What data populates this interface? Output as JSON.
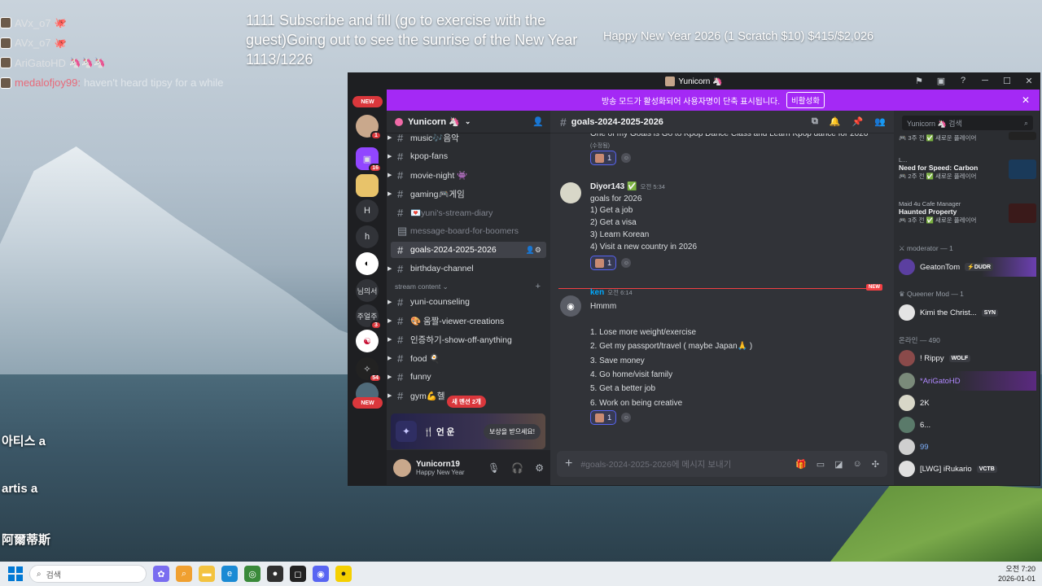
{
  "overlay_chat": [
    {
      "name": "AVx_o7",
      "message": "",
      "emoji": "🐙",
      "highlight": false
    },
    {
      "name": "AVx_o7",
      "message": "",
      "emoji": "🐙",
      "highlight": false
    },
    {
      "name": "AriGatoHD",
      "message": "",
      "emoji": "🦄🦄🦄",
      "highlight": false
    },
    {
      "name": "medalofjoy99:",
      "message": "haven't heard tipsy for a while",
      "emoji": "",
      "highlight": true
    }
  ],
  "stream_goal": "1111 Subscribe and fill (go to exercise with the guest)Going out to see the sunrise of the New Year 1113/1226",
  "new_year_goal": "Happy New Year 2026 (1 Scratch $10) $415/$2,026",
  "side_labels": [
    "아티스 a",
    "artis a",
    "阿爾蒂斯"
  ],
  "window": {
    "title": "Yunicorn 🦄",
    "banner_text": "방송 모드가 활성화되어 사용자명이 단축 표시됩니다.",
    "banner_button": "비활성화",
    "close_x": "✕"
  },
  "servers": {
    "new_pill": "NEW",
    "badges": [
      "1",
      "16",
      "3",
      "54"
    ],
    "letters": [
      "H",
      "h",
      "님의서",
      "주얼주"
    ]
  },
  "guild": {
    "name": "Yunicorn 🦄"
  },
  "channels": [
    {
      "name": "music🎶음악",
      "arrow": true,
      "muted": false
    },
    {
      "name": "kpop-fans",
      "arrow": true,
      "muted": false
    },
    {
      "name": "movie-night 👾",
      "arrow": true,
      "muted": false
    },
    {
      "name": "gaming🎮게임",
      "arrow": true,
      "muted": false
    },
    {
      "name": "💌yuni's-stream-diary",
      "arrow": false,
      "muted": true
    },
    {
      "name": "message-board-for-boomers",
      "arrow": false,
      "muted": true
    },
    {
      "name": "goals-2024-2025-2026",
      "arrow": false,
      "muted": false,
      "selected": true
    },
    {
      "name": "birthday-channel",
      "arrow": true,
      "muted": false
    }
  ],
  "category": "stream content ⌄",
  "channels2": [
    {
      "name": "yuni-counseling",
      "arrow": true
    },
    {
      "name": "🎨 움짤-viewer-creations",
      "arrow": true
    },
    {
      "name": "인증하기-show-off-anything",
      "arrow": true
    },
    {
      "name": "food 🍳",
      "arrow": true
    },
    {
      "name": "funny",
      "arrow": true
    },
    {
      "name": "gym💪헬",
      "arrow": true
    }
  ],
  "new_mentions": "새 멘션 2개",
  "reward": {
    "name": "🍴 언 운",
    "button": "보상을 받으세요!"
  },
  "user": {
    "name": "Yunicorn19",
    "status": "Happy New Year"
  },
  "chat": {
    "channel": "goals-2024-2025-2026",
    "messages": [
      {
        "author": "",
        "time": "",
        "lines": [
          "One of my Goals is Go to Kpop Dance Class and Learn Kpop dance for 2026",
          "(수정됨)"
        ],
        "reaction_count": "1"
      },
      {
        "author": "Diyor143 ✅",
        "time": "오전 5:34",
        "lines": [
          "goals for 2026",
          "1) Get a job",
          "2) Get a visa",
          "3) Learn Korean",
          "4) Visit a new country in 2026"
        ],
        "reaction_count": "1"
      },
      {
        "author": "ken",
        "time": "오전 6:14",
        "lines": [
          "Hmmm",
          "",
          "1. Lose more weight/exercise",
          "2. Get my passport/travel ( maybe Japan🙏 )",
          "3. Save money",
          "4. Go home/visit family",
          "5. Get a better job",
          "6. Work on being creative"
        ],
        "reaction_count": "1"
      }
    ],
    "new_tag": "NEW",
    "placeholder": "#goals-2024-2025-2026에 메시지 보내기"
  },
  "members": {
    "search": "Yunicorn 🦄 검색",
    "cards": [
      {
        "title": "",
        "sub": "🎮 3주 전 ✅ 새로운 플레이어"
      },
      {
        "title": "Need for Speed: Carbon",
        "sub": "🎮 2주 전 ✅ 새로운 플레이어",
        "pre": "L..."
      },
      {
        "title": "Haunted Property",
        "sub": "🎮 3주 전 ✅ 새로운 플레이어",
        "pre": "Maid 4u Cafe Manager"
      }
    ],
    "sections": [
      "moderator — 1",
      "Queener Mod — 1",
      "온라인 — 490"
    ],
    "list": [
      {
        "name": "GeatonTom",
        "tag": "⚡DUDR"
      },
      {
        "name": "Kimi the Christ...",
        "tag": "SYN"
      },
      {
        "name": "! Rippy",
        "tag": "WOLF"
      },
      {
        "name": "*AriGatoHD",
        "tag": ""
      },
      {
        "name": "2K",
        "tag": ""
      },
      {
        "name": "6...",
        "tag": ""
      },
      {
        "name": "99",
        "tag": ""
      },
      {
        "name": "[LWG] iRukario",
        "tag": "VCTB"
      }
    ]
  },
  "taskbar": {
    "search": "검색",
    "time": "오전 7:20",
    "date": "2026-01-01"
  },
  "colors": {
    "accent": "#a429f5",
    "new_red": "#da373c",
    "reaction_blue": "#5865f2"
  }
}
